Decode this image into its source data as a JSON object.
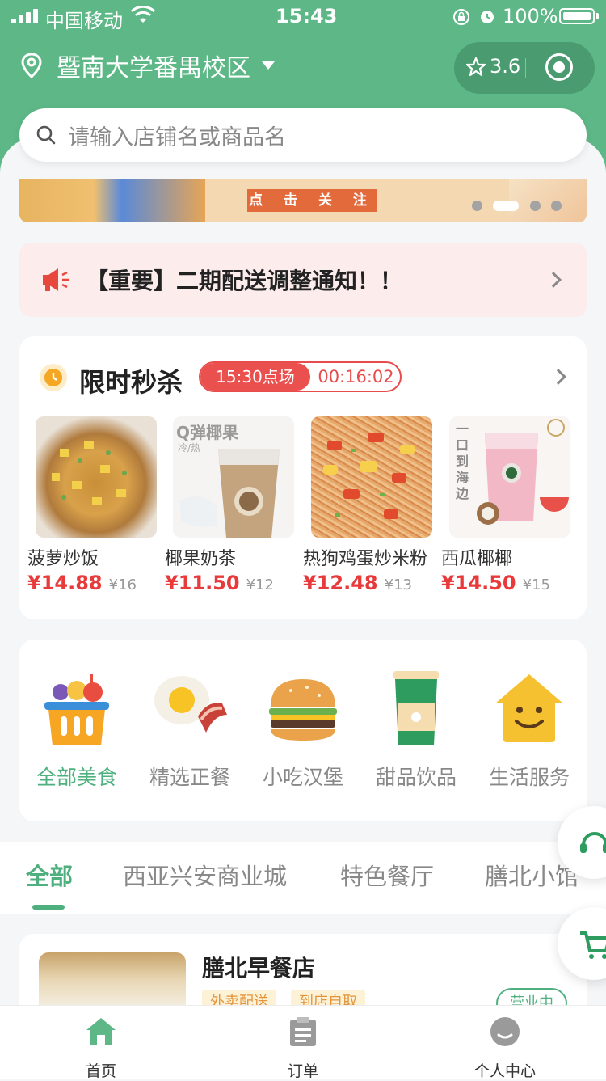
{
  "status_bar": {
    "carrier": "中国移动",
    "time": "15:43",
    "battery": "100%"
  },
  "header": {
    "location": "暨南大学番禺校区",
    "rating": "3.6",
    "search_placeholder": "请输入店铺名或商品名"
  },
  "banner": {
    "follow_label": "点 击 关 注",
    "page_count": 4,
    "active_index": 1
  },
  "notice": {
    "text": "【重要】二期配送调整通知！！"
  },
  "flash_sale": {
    "title": "限时秒杀",
    "session": "15:30点场",
    "countdown": "00:16:02",
    "products": [
      {
        "name": "菠萝炒饭",
        "price": "¥14.88",
        "original": "¥16"
      },
      {
        "name": "椰果奶茶",
        "price": "¥11.50",
        "original": "¥12",
        "img_text": "Q弹椰果",
        "img_sub": "冷/热"
      },
      {
        "name": "热狗鸡蛋炒米粉",
        "price": "¥12.48",
        "original": "¥13"
      },
      {
        "name": "西瓜椰椰",
        "price": "¥14.50",
        "original": "¥15",
        "img_text": "一口到海边"
      }
    ]
  },
  "categories": [
    {
      "label": "全部美食",
      "icon": "basket-icon",
      "active": true
    },
    {
      "label": "精选正餐",
      "icon": "egg-bacon-icon",
      "active": false
    },
    {
      "label": "小吃汉堡",
      "icon": "burger-icon",
      "active": false
    },
    {
      "label": "甜品饮品",
      "icon": "drink-cup-icon",
      "active": false
    },
    {
      "label": "生活服务",
      "icon": "smiley-house-icon",
      "active": false
    }
  ],
  "tabs": [
    "全部",
    "西亚兴安商业城",
    "特色餐厅",
    "膳北小馆"
  ],
  "store": {
    "name": "膳北早餐店",
    "tags": [
      "外卖配送",
      "到店自取"
    ],
    "status": "营业中"
  },
  "bottom_nav": [
    {
      "label": "首页",
      "icon": "home-icon"
    },
    {
      "label": "订单",
      "icon": "orders-icon"
    },
    {
      "label": "个人中心",
      "icon": "profile-icon"
    }
  ],
  "colors": {
    "brand": "#5db786",
    "accent": "#4fb07f",
    "price": "#e83a3a"
  }
}
